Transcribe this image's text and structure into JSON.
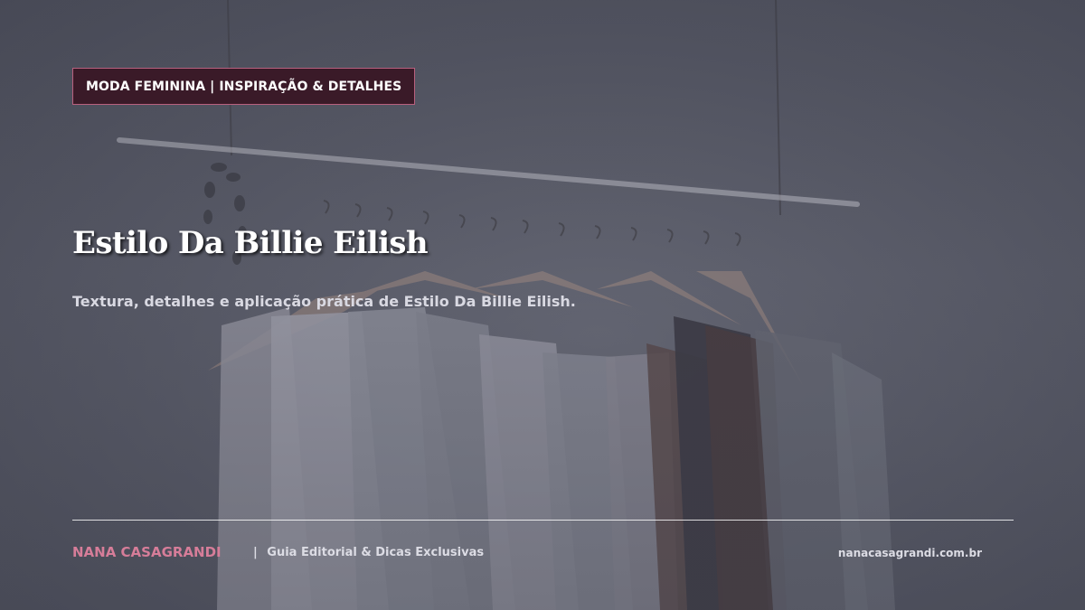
{
  "header": {
    "category_badge": "MODA FEMININA | INSPIRAÇÃO & DETALHES"
  },
  "hero": {
    "title": "Estilo Da Billie Eilish",
    "subtitle": "Textura, detalhes e aplicação prática de Estilo Da Billie Eilish."
  },
  "footer": {
    "brand": "NANA CASAGRANDI",
    "separator": "|",
    "tagline": "Guia Editorial & Dicas Exclusivas",
    "url": "nanacasagrandi.com.br"
  },
  "colors": {
    "badge_background": "#3a1a28",
    "badge_border": "#b8607e",
    "brand_accent": "#d67d99",
    "background": "#5d5f6c"
  }
}
